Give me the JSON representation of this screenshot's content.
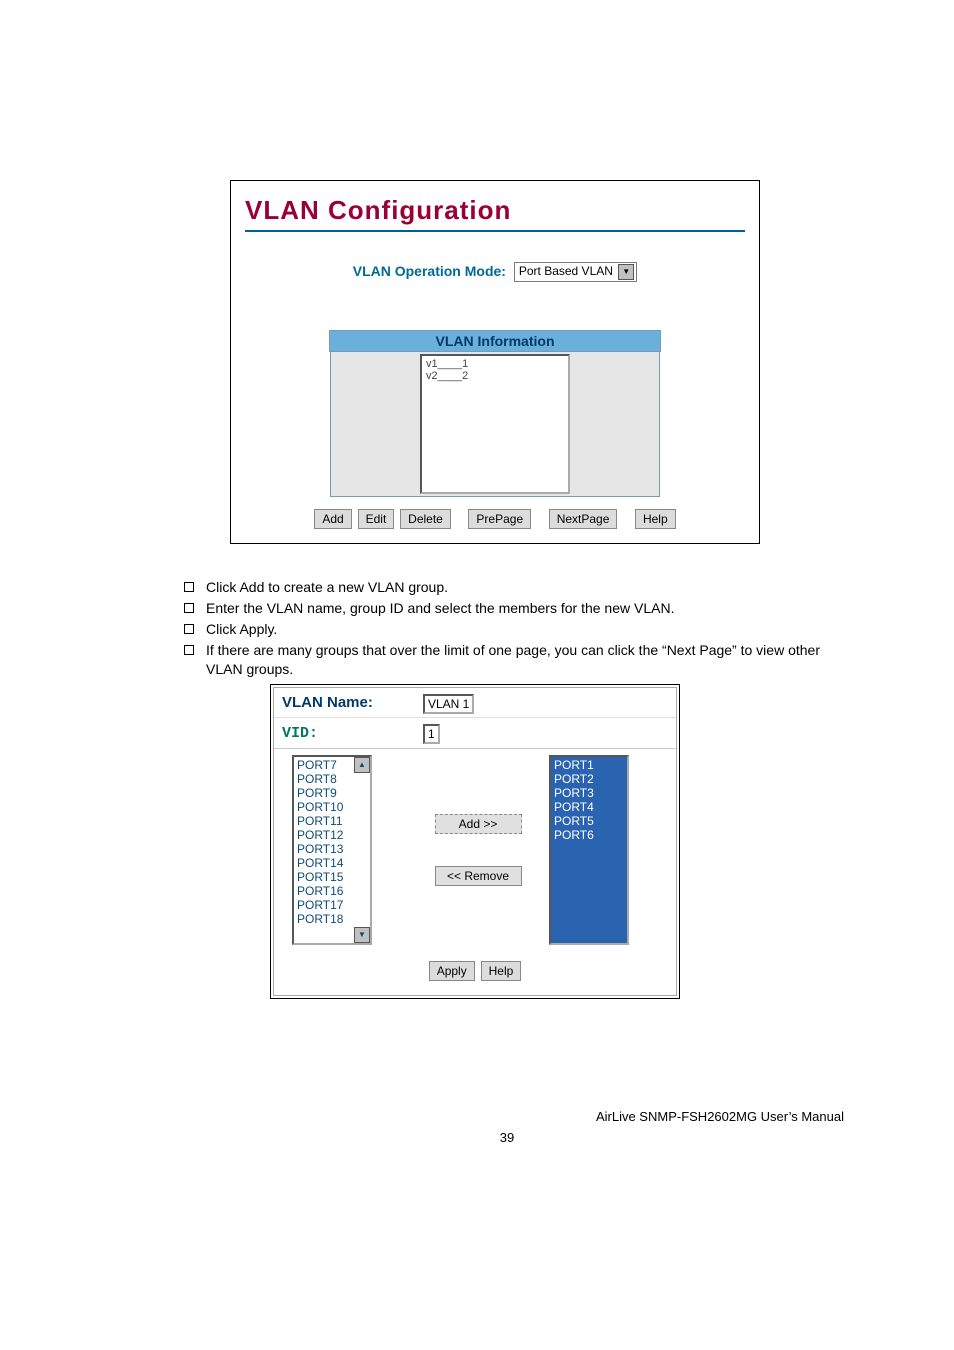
{
  "fig1": {
    "title": "VLAN Configuration",
    "op_label": "VLAN Operation Mode:",
    "op_value": "Port Based VLAN",
    "info_header": "VLAN Information",
    "rows": [
      "v1____1",
      "v2____2"
    ],
    "buttons": {
      "add": "Add",
      "edit": "Edit",
      "delete": "Delete",
      "prepage": "PrePage",
      "nextpage": "NextPage",
      "help": "Help"
    }
  },
  "bullets": [
    "Click Add to create a new VLAN group.",
    "Enter the VLAN name, group ID and select the members for the new VLAN.",
    "Click Apply.",
    "If there are many groups that over the limit of one page, you can click the “Next Page” to view other VLAN groups."
  ],
  "fig2": {
    "name_label": "VLAN Name:",
    "name_value": "VLAN 1",
    "vid_label": "VID:",
    "vid_value": "1",
    "left_ports": [
      "PORT7",
      "PORT8",
      "PORT9",
      "PORT10",
      "PORT11",
      "PORT12",
      "PORT13",
      "PORT14",
      "PORT15",
      "PORT16",
      "PORT17",
      "PORT18"
    ],
    "right_ports": [
      "PORT1",
      "PORT2",
      "PORT3",
      "PORT4",
      "PORT5",
      "PORT6"
    ],
    "btn_add": "Add   >>",
    "btn_remove": "<< Remove",
    "btn_apply": "Apply",
    "btn_help": "Help"
  },
  "footer": "AirLive SNMP-FSH2602MG User’s Manual",
  "page_number": "39"
}
